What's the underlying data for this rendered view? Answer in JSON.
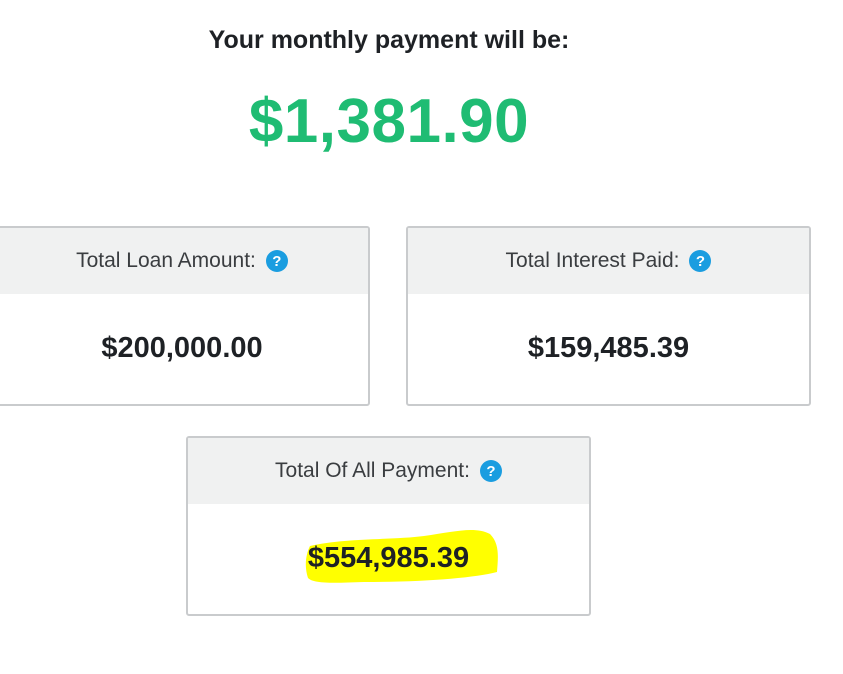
{
  "summary": {
    "headline": "Your monthly payment will be:",
    "monthly_payment": "$1,381.90"
  },
  "cards": {
    "loan": {
      "label": "Total Loan Amount:",
      "value": "$200,000.00",
      "icon": "help-icon"
    },
    "interest": {
      "label": "Total Interest Paid:",
      "value": "$159,485.39",
      "icon": "help-icon"
    },
    "total": {
      "label": "Total Of All Payment:",
      "value": "$554,985.39",
      "icon": "help-icon",
      "highlighted": true
    }
  },
  "icons": {
    "help_glyph": "?"
  },
  "colors": {
    "accent_green": "#1fbc73",
    "help_blue": "#1a9de0",
    "highlight_yellow": "#ffff00",
    "card_header_bg": "#f0f1f1",
    "card_border": "#c9cbcd"
  }
}
